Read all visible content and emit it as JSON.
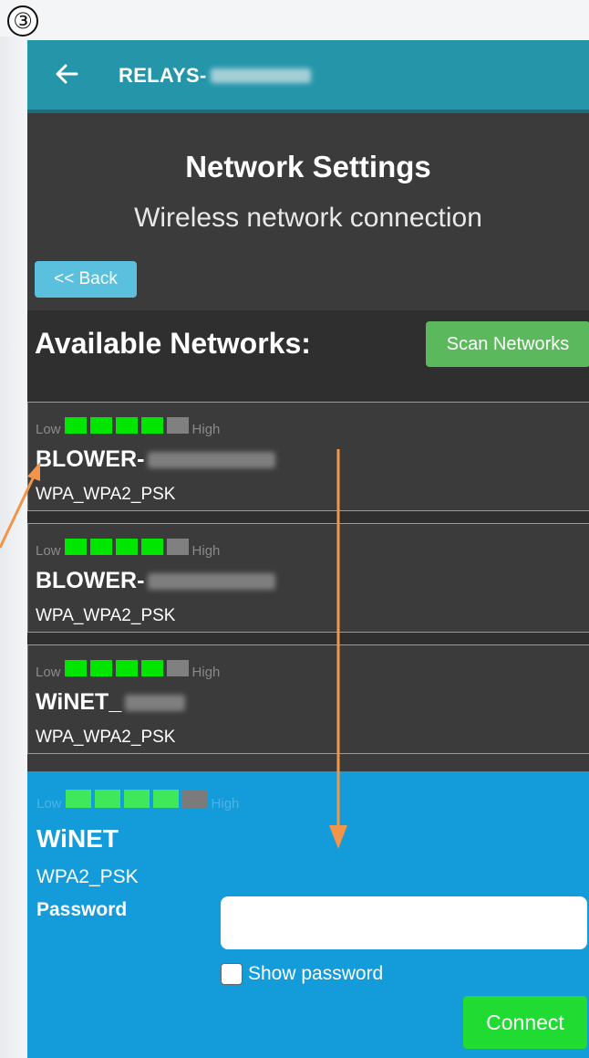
{
  "step_badge": "③",
  "appbar": {
    "title": "RELAYS-"
  },
  "header": {
    "title": "Network Settings",
    "subtitle": "Wireless network connection",
    "back_button": "<< Back"
  },
  "available": {
    "title": "Available Networks:",
    "scan_button": "Scan Networks"
  },
  "signal_labels": {
    "low": "Low",
    "high": "High"
  },
  "networks": [
    {
      "ssid": "BLOWER-",
      "security": "WPA_WPA2_PSK",
      "signal_bars": 4,
      "signal_max": 5
    },
    {
      "ssid": "BLOWER-",
      "security": "WPA_WPA2_PSK",
      "signal_bars": 4,
      "signal_max": 5
    },
    {
      "ssid": "WiNET_",
      "security": "WPA_WPA2_PSK",
      "signal_bars": 4,
      "signal_max": 5
    }
  ],
  "selected_network": {
    "ssid": "WiNET",
    "security": "WPA2_PSK",
    "signal_bars": 4,
    "signal_max": 5,
    "password_label": "Password",
    "password_value": "",
    "show_password_label": "Show password",
    "show_password_checked": false,
    "connect_button": "Connect"
  },
  "colors": {
    "appbar": "#2596aa",
    "panel": "#3b3b3b",
    "selected": "#149bd9",
    "signal_on": "#00e600",
    "signal_off": "#808080",
    "back_button": "#5bc0de",
    "scan_button": "#5cb85c",
    "connect_button": "#1fdb32",
    "annotation_arrow": "#f0954a"
  }
}
